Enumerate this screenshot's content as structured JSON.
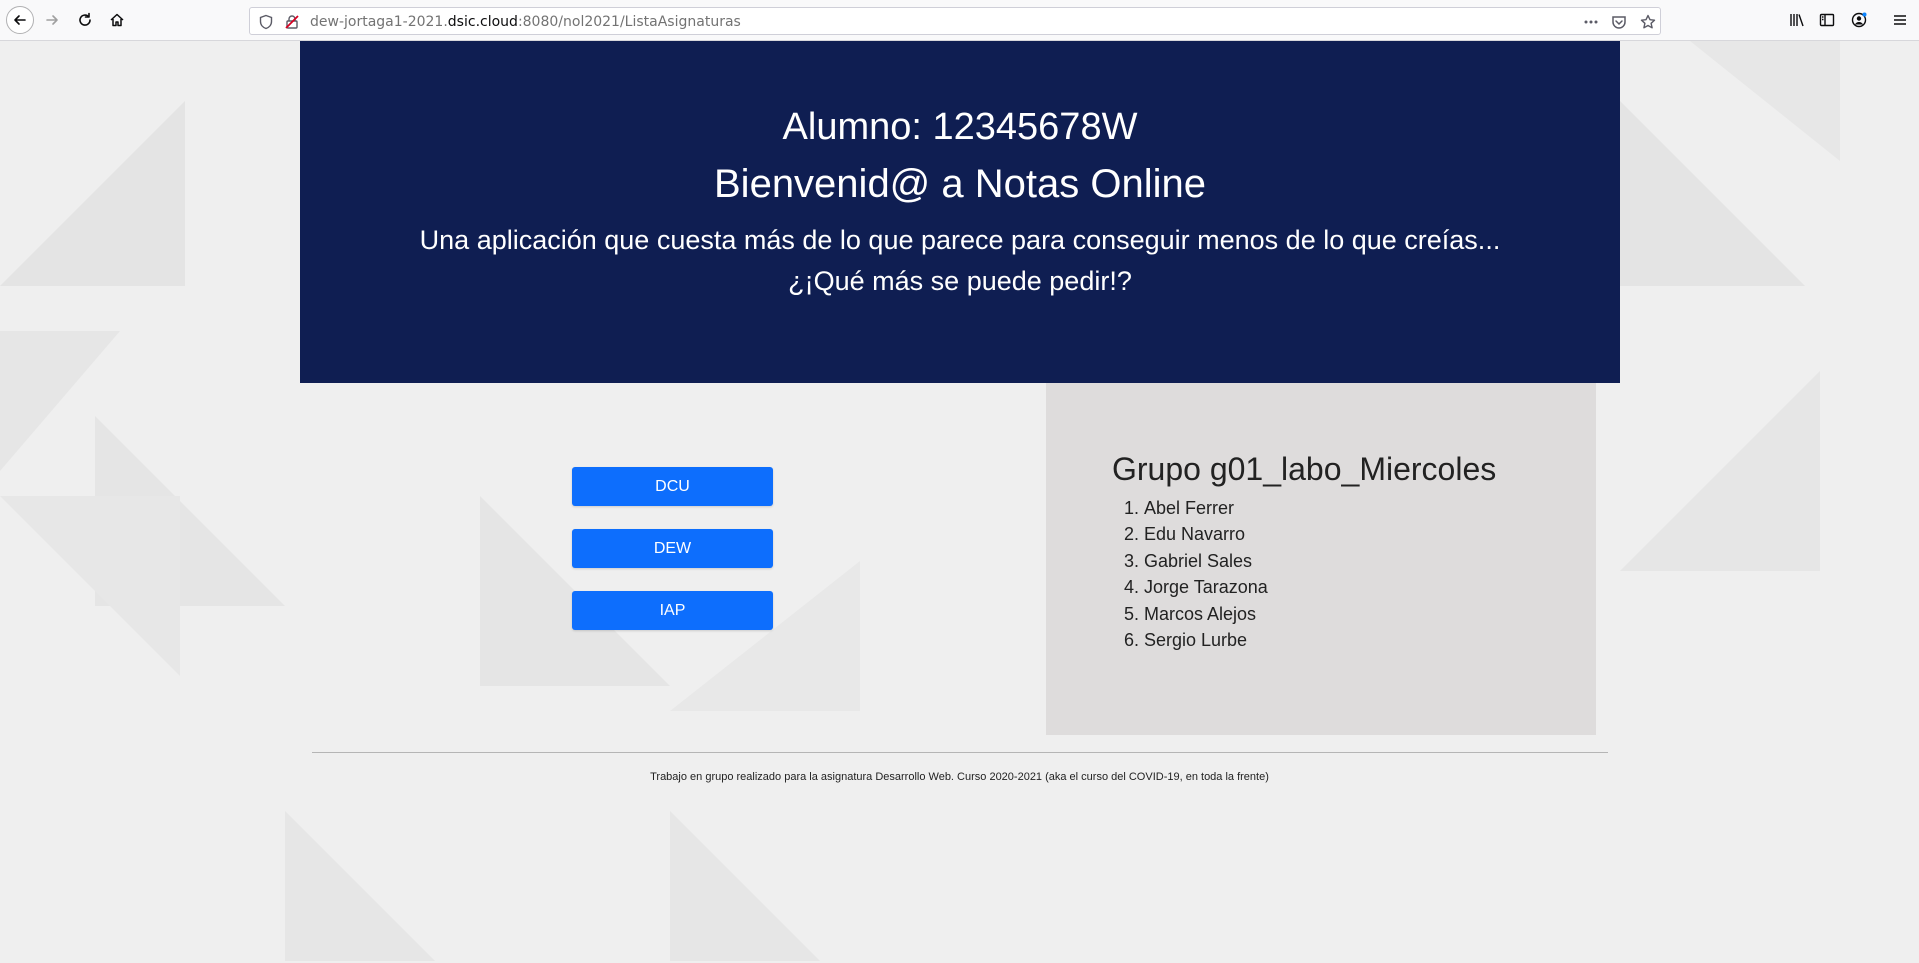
{
  "browser": {
    "url_prefix": "dew-jortaga1-2021.",
    "url_domain": "dsic.cloud",
    "url_suffix": ":8080/nol2021/ListaAsignaturas"
  },
  "header": {
    "student": "Alumno: 12345678W",
    "welcome": "Bienvenid@ a Notas Online",
    "tagline_line1": "Una aplicación que cuesta más de lo que parece para conseguir menos de lo que creías...",
    "tagline_line2": "¿¡Qué más se puede pedir!?",
    "background": "#0f1e52"
  },
  "subjects": [
    "DCU",
    "DEW",
    "IAP"
  ],
  "group": {
    "title": "Grupo g01_labo_Miercoles",
    "members": [
      "Abel Ferrer",
      "Edu Navarro",
      "Gabriel Sales",
      "Jorge Tarazona",
      "Marcos Alejos",
      "Sergio Lurbe"
    ]
  },
  "footer": {
    "text": "Trabajo en grupo realizado para la asignatura Desarrollo Web. Curso 2020-2021 (aka el curso del COVID-19, en toda la frente)"
  },
  "colors": {
    "button": "#0d6efd",
    "panel": "#dedcdc"
  }
}
